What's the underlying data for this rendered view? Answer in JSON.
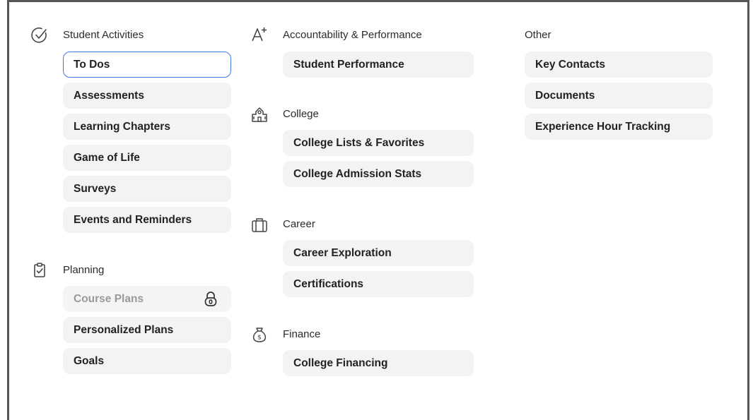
{
  "sections": {
    "student_activities": {
      "title": "Student Activities",
      "icon": "check-circle-icon",
      "items": [
        "To Dos",
        "Assessments",
        "Learning Chapters",
        "Game of Life",
        "Surveys",
        "Events and Reminders"
      ]
    },
    "planning": {
      "title": "Planning",
      "icon": "clipboard-check-icon",
      "items": [
        "Course Plans",
        "Personalized Plans",
        "Goals"
      ]
    },
    "accountability": {
      "title": "Accountability & Performance",
      "icon": "a-plus-icon",
      "items": [
        "Student Performance"
      ]
    },
    "college": {
      "title": "College",
      "icon": "school-building-icon",
      "items": [
        "College Lists & Favorites",
        "College Admission Stats"
      ]
    },
    "career": {
      "title": "Career",
      "icon": "briefcase-icon",
      "items": [
        "Career Exploration",
        "Certifications"
      ]
    },
    "finance": {
      "title": "Finance",
      "icon": "money-bag-icon",
      "items": [
        "College Financing"
      ]
    },
    "other": {
      "title": "Other",
      "items": [
        "Key Contacts",
        "Documents",
        "Experience Hour Tracking"
      ]
    }
  },
  "state": {
    "selected_item": "To Dos",
    "locked_item": "Course Plans"
  },
  "colors": {
    "selected_border": "#3b7bd6",
    "item_background": "#f3f3f3",
    "locked_text": "#9a9a9a",
    "frame_border": "#555555"
  }
}
